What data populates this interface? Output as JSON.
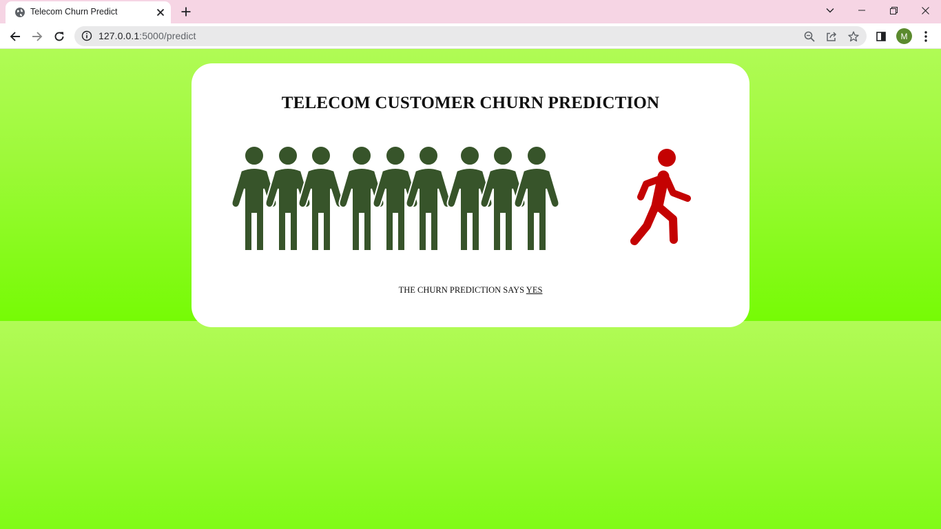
{
  "browser": {
    "tab_title": "Telecom Churn Predict",
    "url_host": "127.0.0.1",
    "url_path": ":5000/predict",
    "profile_initial": "M",
    "icons": {
      "favicon": "globe-icon",
      "tab_close": "close-icon",
      "new_tab": "plus-icon",
      "tab_search": "chevron-down-icon",
      "back": "arrow-left-icon",
      "forward": "arrow-right-icon",
      "reload": "reload-icon",
      "site_info": "info-icon",
      "zoom": "zoom-out-icon",
      "share": "share-icon",
      "bookmark": "star-icon",
      "side_panel": "side-panel-icon",
      "menu": "kebab-menu-icon"
    }
  },
  "page": {
    "title": "TELECOM CUSTOMER CHURN PREDICTION",
    "result_prefix": "THE CHURN PREDICTION SAYS",
    "result_value": "YES",
    "crowd_count": 9,
    "colors": {
      "crowd": "#37542a",
      "runner": "#c40202",
      "background": "#9ef93a"
    },
    "icons": {
      "crowd": "people-group-icon",
      "runner": "running-person-icon"
    }
  }
}
